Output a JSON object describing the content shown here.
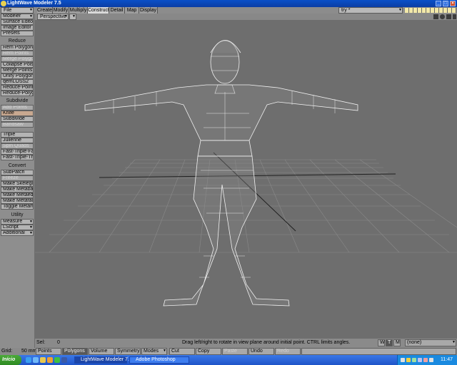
{
  "window": {
    "title": "LightWave Modeler 7.5"
  },
  "menubar": {
    "file": "File",
    "tabs": [
      {
        "label": "Create"
      },
      {
        "label": "Modify"
      },
      {
        "label": "Multiply"
      },
      {
        "label": "Construct"
      },
      {
        "label": "Detail"
      },
      {
        "label": "Map"
      },
      {
        "label": "Display"
      }
    ],
    "active_tab": "Construct",
    "layer_dropdown": "try *"
  },
  "sidebar": {
    "top_dropdowns": [
      "Modeler",
      "Surface Editor",
      "Image Editor",
      "Presets"
    ],
    "sections": [
      {
        "header": "Reduce",
        "items": [
          "Rem Polygons",
          "Rem Points",
          "Merge Polygons",
          "Collapse Pols",
          "Merge Points",
          "Unify Polygons",
          "qemLOSS2",
          "Reduce-Points",
          "Reduce-Polygons"
        ]
      },
      {
        "header": "Subdivide",
        "items": [
          "Add Points",
          "Knife",
          "Subdivide",
          "Bandsaw",
          "Triple",
          "Julienne",
          "Spin Quads",
          "Fast-Triple-Fan",
          "Fast-Triple-Trave"
        ]
      },
      {
        "header": "Convert",
        "items": [
          "SubPatch",
          "Freeze",
          "Make Skelegons",
          "Make Metaballs",
          "Make Metaedges",
          "Make Metafaces",
          "Toggle Metamesh"
        ]
      },
      {
        "header": "Utility",
        "items": [
          "Measure",
          "LScript",
          "Additional"
        ]
      }
    ]
  },
  "viewport": {
    "view_dropdown": "Perspective"
  },
  "status": {
    "sel_label": "Sel:",
    "sel_value": "0",
    "grid_label": "Grid:",
    "grid_value": "50 mm",
    "help_text": "Drag left/right to rotate in view plane around initial point. CTRL limits angles.",
    "wtm": [
      "W",
      "T",
      "M"
    ],
    "vmap": "(none)"
  },
  "bottombar": {
    "buttons": [
      "Points",
      "Polygons",
      "Volume",
      "Symmetry",
      "Modes",
      "Cut",
      "Copy",
      "Paste",
      "Undo",
      "Redo"
    ],
    "active": "Polygons"
  },
  "taskbar": {
    "start": "Início",
    "tasks": [
      "LightWave Modeler 7.5",
      "Adobe Photoshop"
    ],
    "clock": "11:47"
  },
  "colors": {
    "viewport_bg": "#6e6e6e",
    "wire": "#f0f0f0",
    "grid": "#8a8a8a",
    "title_blue": "#0b3ea4"
  }
}
